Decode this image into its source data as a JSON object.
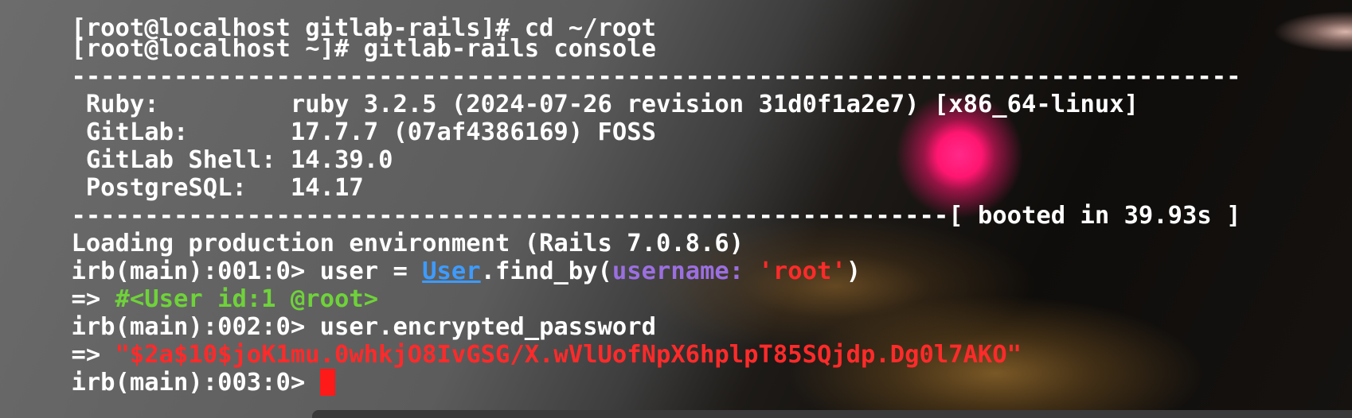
{
  "terminal": {
    "top_partial": "[root@localhost gitlab-rails]# cd ~/root",
    "prompt_cmd": "[root@localhost ~]# gitlab-rails console",
    "separator_top": "--------------------------------------------------------------------------------",
    "info": [
      {
        "label": " Ruby:         ",
        "value": "ruby 3.2.5 (2024-07-26 revision 31d0f1a2e7) [x86_64-linux]"
      },
      {
        "label": " GitLab:       ",
        "value": "17.7.7 (07af4386169) FOSS"
      },
      {
        "label": " GitLab Shell: ",
        "value": "14.39.0"
      },
      {
        "label": " PostgreSQL:   ",
        "value": "14.17"
      }
    ],
    "separator_bottom_dashes": "------------------------------------------------------------",
    "booted": "[ booted in 39.93s ]",
    "loading": "Loading production environment (Rails 7.0.8.6)",
    "irb1_prompt": "irb(main):001:0> ",
    "irb1_pre": "user = ",
    "irb1_class": "User",
    "irb1_method": ".find_by(",
    "irb1_key": "username:",
    "irb1_space": " ",
    "irb1_str": "'root'",
    "irb1_close": ")",
    "result1_arrow": "=> ",
    "result1_value": "#<User id:1 @root>",
    "irb2_prompt": "irb(main):002:0> ",
    "irb2_cmd": "user.encrypted_password",
    "result2_arrow": "=> ",
    "result2_value": "\"$2a$10$joK1mu.0whkjO8IvGSG/X.wVlUofNpX6hplpT85SQjdp.Dg0l7AKO\"",
    "irb3_prompt": "irb(main):003:0> "
  },
  "colors": {
    "class": "#3d9bff",
    "symbol": "#9b6fe0",
    "string": "#ff2a2a",
    "object": "#6fd23a",
    "cursor": "#ff1a1a"
  }
}
